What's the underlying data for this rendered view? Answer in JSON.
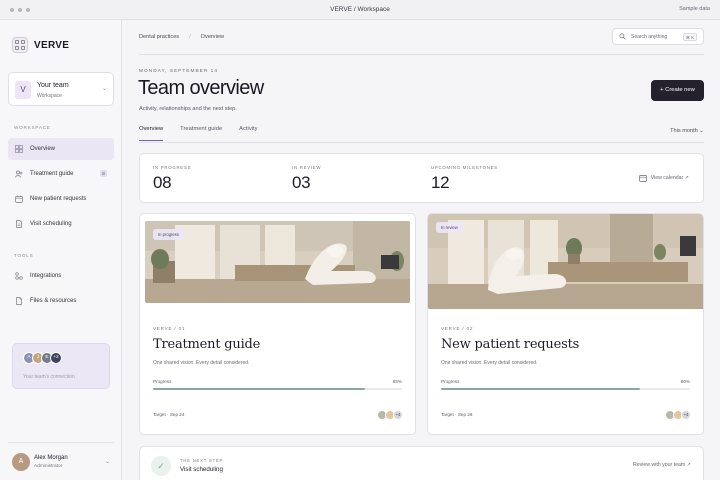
{
  "window": {
    "title": "VERVE / Workspace",
    "right_label": "Sample data"
  },
  "brand": {
    "name": "VERVE"
  },
  "team": {
    "initial": "V",
    "name": "Your team",
    "sub": "Workspace"
  },
  "sidebar": {
    "workspace_label": "WORKSPACE",
    "items": [
      {
        "label": "Overview",
        "icon": "grid-icon"
      },
      {
        "label": "Treatment guide",
        "icon": "users-icon",
        "badge": "8"
      },
      {
        "label": "New patient requests",
        "icon": "calendar-icon"
      },
      {
        "label": "Visit scheduling",
        "icon": "document-icon"
      }
    ],
    "tools_label": "TOOLS",
    "tools": [
      {
        "label": "Integrations",
        "icon": "integrations-icon"
      },
      {
        "label": "Files & resources",
        "icon": "file-icon"
      }
    ],
    "connect": {
      "avatars": [
        "A",
        "J",
        "E",
        "+2"
      ],
      "text": "Your team's connection"
    }
  },
  "user": {
    "initial": "A",
    "name": "Alex Morgan",
    "role": "Administrator"
  },
  "header": {
    "breadcrumbs": [
      "Dental practices",
      "Overview"
    ],
    "search_placeholder": "Search anything",
    "search_shortcut": "⌘ K",
    "date": "MONDAY, SEPTEMBER 14",
    "title": "Team overview",
    "subtitle": "Activity, relationships and the next step.",
    "create_label": "+ Create new"
  },
  "tabs": [
    "Overview",
    "Treatment guide",
    "Activity"
  ],
  "period": "This month ⌄",
  "stats": [
    {
      "label": "IN PROGRESS",
      "value": "08"
    },
    {
      "label": "IN REVIEW",
      "value": "03"
    },
    {
      "label": "UPCOMING MILESTONES",
      "value": "12"
    }
  ],
  "view_calendar": "View calendar ↗",
  "cards": [
    {
      "badge": "In progress",
      "eyebrow": "VERVE / 01",
      "title": "Treatment guide",
      "desc": "One shared vision. Every detail considered.",
      "progress_label": "Progress",
      "progress_pct": "85%",
      "progress": 0.85,
      "target": "Target · Sep 24",
      "avatars": [
        "",
        "",
        "+4"
      ]
    },
    {
      "badge": "In review",
      "eyebrow": "VERVE / 02",
      "title": "New patient requests",
      "desc": "One shared vision. Every detail considered.",
      "progress_label": "Progress",
      "progress_pct": "80%",
      "progress": 0.8,
      "target": "Target · Sep 28",
      "avatars": [
        "",
        "",
        "+4"
      ]
    }
  ],
  "next_step": {
    "eyebrow": "THE NEXT STEP",
    "title": "Visit scheduling",
    "link": "Review with your team ↗"
  },
  "colors": {
    "accent": "#24212d",
    "active_nav": "#ebe6f4",
    "progress": "#8aa99b"
  }
}
